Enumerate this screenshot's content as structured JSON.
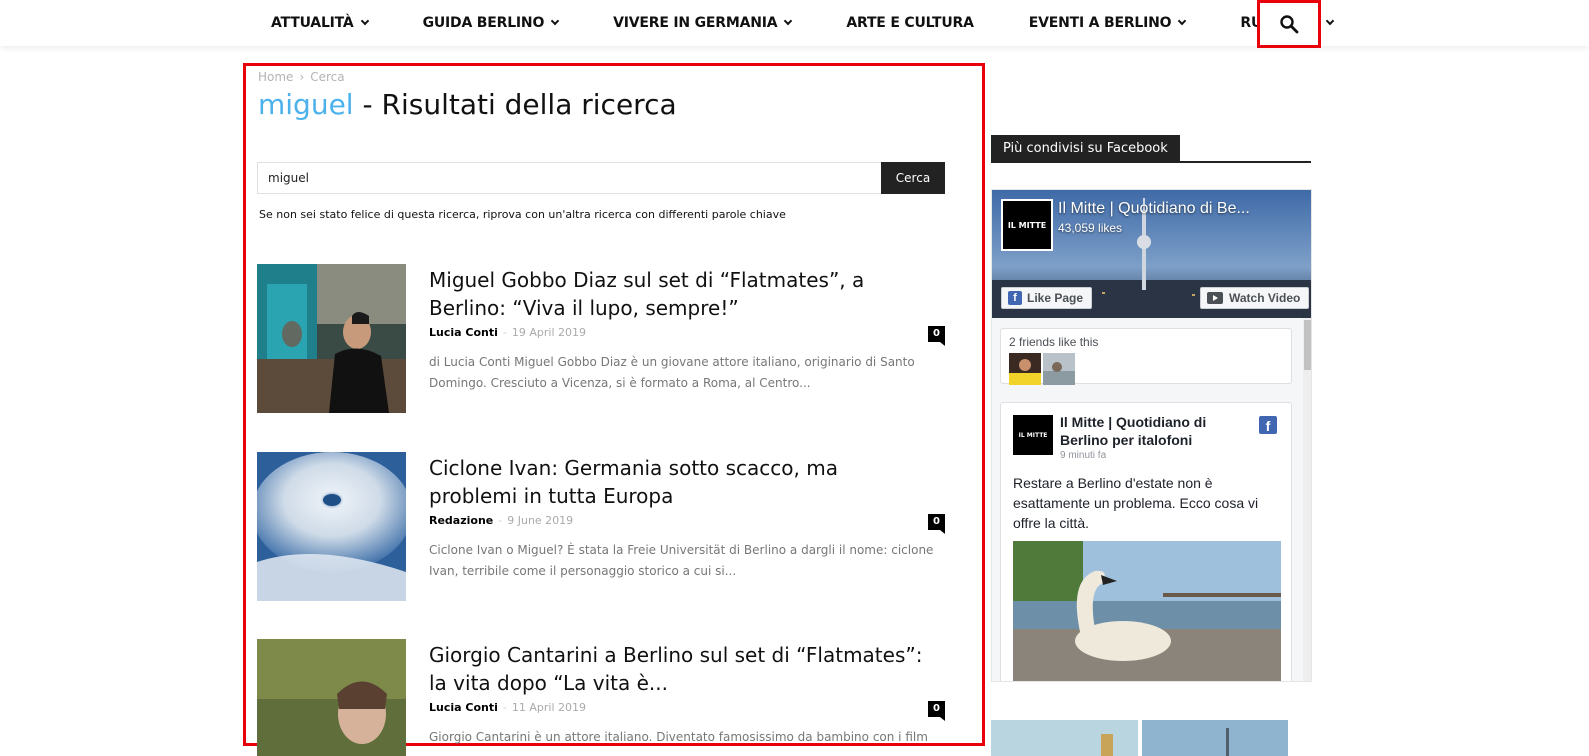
{
  "nav": {
    "items": [
      {
        "label": "ATTUALITÀ",
        "has_dropdown": true
      },
      {
        "label": "GUIDA BERLINO",
        "has_dropdown": true
      },
      {
        "label": "VIVERE IN GERMANIA",
        "has_dropdown": true
      },
      {
        "label": "ARTE E CULTURA",
        "has_dropdown": false
      },
      {
        "label": "EVENTI A BERLINO",
        "has_dropdown": true
      },
      {
        "label": "RUBRICHE",
        "has_dropdown": true
      }
    ],
    "search_icon": "search-icon"
  },
  "breadcrumb": {
    "home": "Home",
    "separator": "›",
    "current": "Cerca"
  },
  "title": {
    "keyword": "miguel",
    "suffix": " - Risultati della ricerca"
  },
  "search": {
    "value": "miguel",
    "button_label": "Cerca",
    "hint": "Se non sei stato felice di questa ricerca, riprova con un'altra ricerca con differenti parole chiave"
  },
  "articles": [
    {
      "title": "Miguel Gobbo Diaz sul set di “Flatmates”, a Berlino: “Viva il lupo, sempre!”",
      "author": "Lucia Conti",
      "date": "19 April 2019",
      "comments": "0",
      "excerpt": "di Lucia Conti Miguel Gobbo Diaz è un giovane attore italiano, originario di Santo Domingo. Cresciuto a Vicenza, si è formato a Roma, al Centro..."
    },
    {
      "title": "Ciclone Ivan: Germania sotto scacco, ma problemi in tutta Europa",
      "author": "Redazione",
      "date": "9 June 2019",
      "comments": "0",
      "excerpt": "Ciclone Ivan o Miguel? È stata la Freie Universität di Berlino a dargli il nome: ciclone Ivan, terribile come il personaggio storico a cui si..."
    },
    {
      "title": "Giorgio Cantarini a Berlino sul set di “Flatmates”: la vita dopo “La vita è...",
      "author": "Lucia Conti",
      "date": "11 April 2019",
      "comments": "0",
      "excerpt": "Giorgio Cantarini è un attore italiano. Diventato famosissimo da bambino con i film"
    }
  ],
  "sidebar": {
    "header": "Più condivisi su Facebook",
    "fb": {
      "page_name": "Il Mitte | Quotidiano di Be...",
      "likes": "43,059 likes",
      "logo_text": "IL MITTE",
      "like_button": "Like Page",
      "watch_button": "Watch Video",
      "friends_label": "2 friends like this",
      "post": {
        "author": "Il Mitte | Quotidiano di Berlino per italofoni",
        "time": "9 minuti fa",
        "text": "Restare a Berlino d'estate non è esattamente un problema. Ecco cosa vi offre la città."
      }
    }
  },
  "colors": {
    "accent_blue": "#4db2ec",
    "highlight_red": "#e8000b",
    "facebook_blue": "#4267b2",
    "dark": "#222222"
  }
}
